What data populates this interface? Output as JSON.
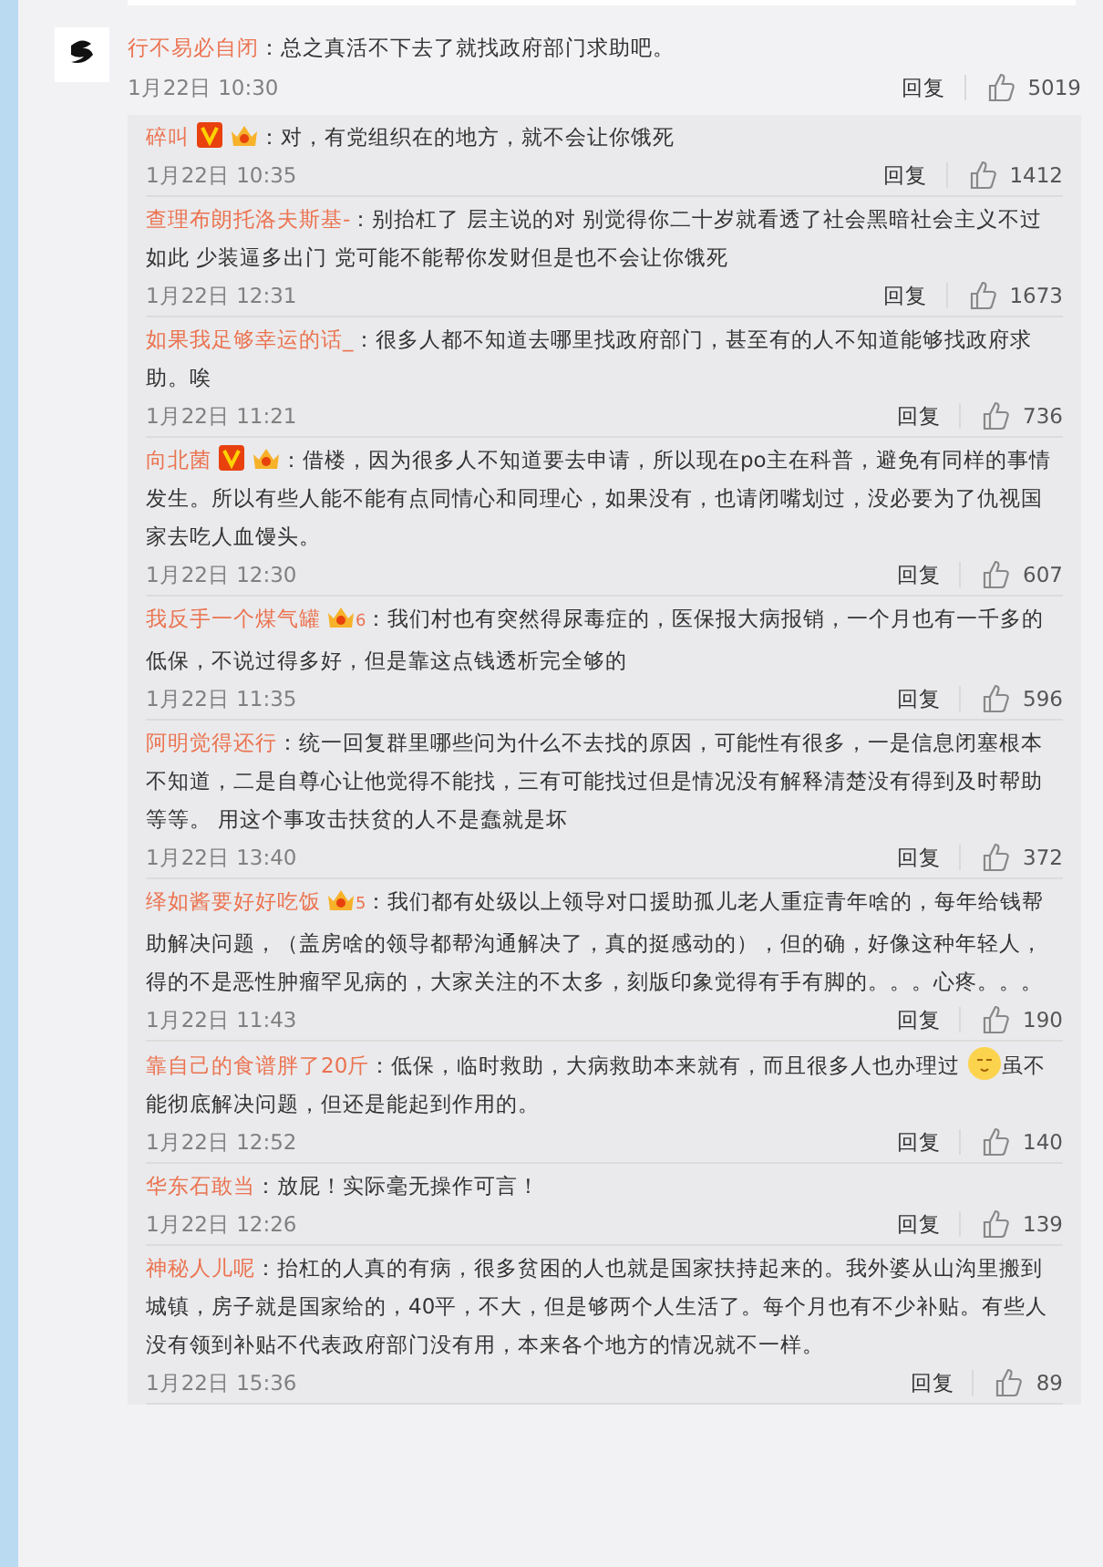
{
  "comment": {
    "user": "行不易必自闭",
    "text": "：总之真活不下去了就找政府部门求助吧。",
    "time": "1月22日 10:30",
    "reply_label": "回复",
    "likes": "5019"
  },
  "replies": [
    {
      "user": "碎叫",
      "verified": true,
      "vip": true,
      "text": "：对，有党组织在的地方，就不会让你饿死",
      "time": "1月22日 10:35",
      "reply_label": "回复",
      "likes": "1412"
    },
    {
      "user": "查理布朗托洛夫斯基-",
      "text": "：别抬杠了 层主说的对 别觉得你二十岁就看透了社会黑暗社会主义不过如此 少装逼多出门 党可能不能帮你发财但是也不会让你饿死",
      "time": "1月22日 12:31",
      "reply_label": "回复",
      "likes": "1673"
    },
    {
      "user": "如果我足够幸运的话_",
      "text": "：很多人都不知道去哪里找政府部门，甚至有的人不知道能够找政府求助。唉",
      "time": "1月22日 11:21",
      "reply_label": "回复",
      "likes": "736"
    },
    {
      "user": "向北菌",
      "verified": true,
      "vip": true,
      "text": "：借楼，因为很多人不知道要去申请，所以现在po主在科普，避免有同样的事情发生。所以有些人能不能有点同情心和同理心，如果没有，也请闭嘴划过，没必要为了仇视国家去吃人血馒头。",
      "time": "1月22日 12:30",
      "reply_label": "回复",
      "likes": "607"
    },
    {
      "user": "我反手一个煤气罐",
      "vip": true,
      "vip_rank": "6",
      "text": "：我们村也有突然得尿毒症的，医保报大病报销，一个月也有一千多的低保，不说过得多好，但是靠这点钱透析完全够的",
      "time": "1月22日 11:35",
      "reply_label": "回复",
      "likes": "596"
    },
    {
      "user": "阿明觉得还行",
      "text": "：统一回复群里哪些问为什么不去找的原因，可能性有很多，一是信息闭塞根本不知道，二是自尊心让他觉得不能找，三有可能找过但是情况没有解释清楚没有得到及时帮助等等。 用这个事攻击扶贫的人不是蠢就是坏",
      "time": "1月22日 13:40",
      "reply_label": "回复",
      "likes": "372"
    },
    {
      "user": "绎如酱要好好吃饭",
      "vip": true,
      "vip_rank": "5",
      "text": "：我们都有处级以上领导对口援助孤儿老人重症青年啥的，每年给钱帮助解决问题，（盖房啥的领导都帮沟通解决了，真的挺感动的），但的确，好像这种年轻人，得的不是恶性肿瘤罕见病的，大家关注的不太多，刻版印象觉得有手有脚的。。。心疼。。。",
      "time": "1月22日 11:43",
      "reply_label": "回复",
      "likes": "190"
    },
    {
      "user": "靠自己的食谱胖了20斤",
      "text": "：低保，临时救助，大病救助本来就有，而且很多人也办理过",
      "emoji": true,
      "text_after": "虽不能彻底解决问题，但还是能起到作用的。",
      "time": "1月22日 12:52",
      "reply_label": "回复",
      "likes": "140"
    },
    {
      "user": "华东石敢当",
      "text": "：放屁！实际毫无操作可言！",
      "time": "1月22日 12:26",
      "reply_label": "回复",
      "likes": "139"
    },
    {
      "user": "神秘人儿呢",
      "text": "：抬杠的人真的有病，很多贫困的人也就是国家扶持起来的。我外婆从山沟里搬到城镇，房子就是国家给的，40平，不大，但是够两个人生活了。每个月也有不少补贴。有些人没有领到补贴不代表政府部门没有用，本来各个地方的情况就不一样。",
      "time": "1月22日 15:36",
      "reply_label": "回复",
      "likes": "89"
    }
  ]
}
